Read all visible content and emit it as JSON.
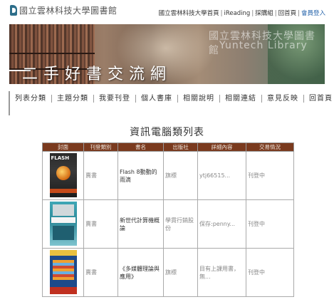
{
  "header": {
    "logo_text": "國立雲林科技大學圖書館",
    "links": [
      "國立雲林科技大學首頁",
      "iReading",
      "採購組",
      "回首頁"
    ],
    "login": "會員登入"
  },
  "banner": {
    "library_zh": "國立雲林科技大學圖書館",
    "library_en": "Yuntech Library",
    "title": "二手好書交流網"
  },
  "nav": {
    "items": [
      "列表分類",
      "主題分類",
      "我要刊登",
      "個人書庫",
      "相關說明",
      "相關連結",
      "意見反映",
      "回首頁"
    ]
  },
  "page_title": "資訊電腦類列表",
  "table": {
    "headers": [
      "封面",
      "刊登類別",
      "書名",
      "出版社",
      "詳細內容",
      "交易情況"
    ],
    "rows": [
      {
        "category": "賣書",
        "name": "Flash 8動動的雨滴",
        "publisher": "旗標",
        "detail": "ytj66515...",
        "status": "刊登中",
        "cover_icon": "flash-book-cover"
      },
      {
        "category": "賣書",
        "name": "新世代計算機概論",
        "publisher": "學貫行銷股份",
        "detail": "保存:penny...",
        "status": "刊登中",
        "cover_icon": "computer-book-cover"
      },
      {
        "category": "賣書",
        "name": "《多媒體理論與應用》",
        "publisher": "旗標",
        "detail": "目有上課用書，無...",
        "status": "刊登中",
        "cover_icon": "multimedia-book-cover"
      }
    ]
  }
}
